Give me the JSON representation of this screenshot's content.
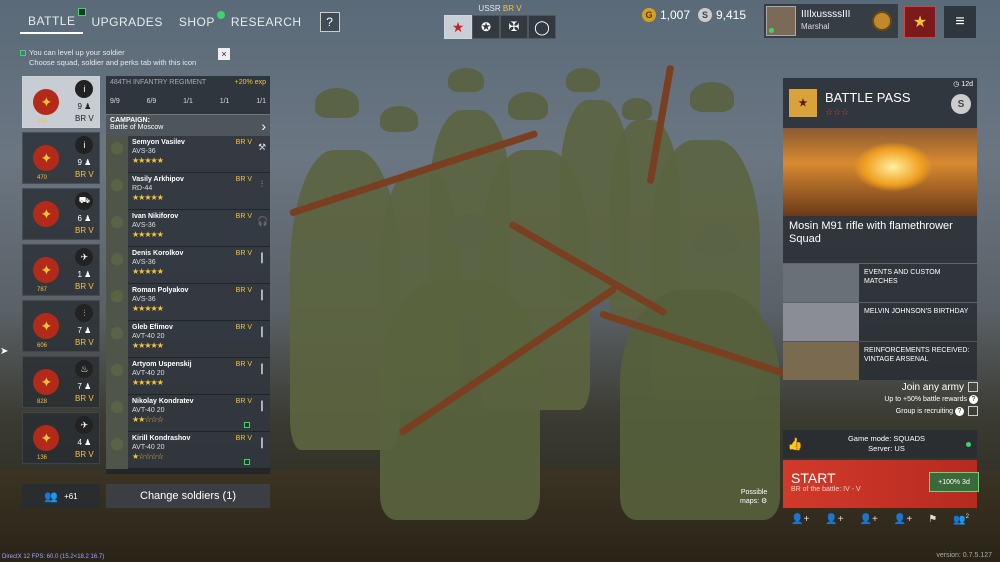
{
  "nav": {
    "tabs": [
      "BATTLE",
      "UPGRADES",
      "SHOP",
      "RESEARCH"
    ],
    "help": "?"
  },
  "nation": {
    "label": "USSR",
    "br": "BR V"
  },
  "currency": {
    "gold": "1,007",
    "silver": "9,415"
  },
  "profile": {
    "name": "IIIlxussssIII",
    "rank": "Marshal"
  },
  "hint": {
    "line1": "You can level up your soldier",
    "line2": "Choose squad, soldier and perks tab with this icon",
    "close": "×"
  },
  "squads": [
    {
      "level": "484",
      "count": "9",
      "br": "BR V",
      "cls": "i"
    },
    {
      "level": "470",
      "count": "9",
      "br": "BR V",
      "cls": "i"
    },
    {
      "level": "",
      "count": "6",
      "br": "BR V",
      "cls": "⛟"
    },
    {
      "level": "787",
      "count": "1",
      "br": "BR V",
      "cls": "✈"
    },
    {
      "level": "606",
      "count": "7",
      "br": "BR V",
      "cls": "⫶"
    },
    {
      "level": "828",
      "count": "7",
      "br": "BR V",
      "cls": "♨"
    },
    {
      "level": "136",
      "count": "4",
      "br": "BR V",
      "cls": "✈"
    }
  ],
  "regiment": {
    "name": "484TH INFANTRY REGIMENT",
    "exp": "+20% exp",
    "stats": [
      "9/9",
      "6/9",
      "1/1",
      "1/1",
      "1/1"
    ],
    "campaign_label": "CAMPAIGN:",
    "campaign": "Battle of Moscow"
  },
  "soldiers": [
    {
      "name": "Semyon Vasilev",
      "weapon": "AVS-36",
      "stars": "★★★★★",
      "br": "BR V",
      "eq": "⚒"
    },
    {
      "name": "Vasily Arkhipov",
      "weapon": "RD-44",
      "stars": "★★★★★",
      "br": "BR V",
      "eq": "⫶"
    },
    {
      "name": "Ivan Nikiforov",
      "weapon": "AVS-36",
      "stars": "★★★★★",
      "br": "BR V",
      "eq": "🎧"
    },
    {
      "name": "Denis Korolkov",
      "weapon": "AVS-36",
      "stars": "★★★★★",
      "br": "BR V",
      "eq": "┃"
    },
    {
      "name": "Roman Polyakov",
      "weapon": "AVS-36",
      "stars": "★★★★★",
      "br": "BR V",
      "eq": "┃"
    },
    {
      "name": "Gleb Efimov",
      "weapon": "AVT-40 20",
      "stars": "★★★★★",
      "br": "BR V",
      "eq": "┃"
    },
    {
      "name": "Artyom Uspenskij",
      "weapon": "AVT-40 20",
      "stars": "★★★★★",
      "br": "BR V",
      "eq": "┃"
    },
    {
      "name": "Nikolay Kondratev",
      "weapon": "AVT-40 20",
      "stars": "★★☆☆☆",
      "br": "BR V",
      "eq": "┃"
    },
    {
      "name": "Kirill Kondrashov",
      "weapon": "AVT-40 20",
      "stars": "★☆☆☆☆",
      "br": "BR V",
      "eq": "┃"
    }
  ],
  "reserve": "+61",
  "change_soldiers": "Change soldiers (1)",
  "battlepass": {
    "title": "BATTLE PASS",
    "stars": "☆☆☆",
    "days": "12d",
    "silver": "S",
    "caption": "Mosin M91 rifle with flamethrower Squad"
  },
  "events": [
    {
      "text": "EVENTS AND CUSTOM MATCHES"
    },
    {
      "text": "MELVIN JOHNSON'S BIRTHDAY"
    },
    {
      "text": "REINFORCEMENTS RECEIVED: VINTAGE ARSENAL"
    }
  ],
  "join": {
    "title": "Join any army",
    "bonus": "Up to +50% battle rewards",
    "recruit": "Group is recruiting"
  },
  "mode": {
    "line1": "Game mode: SQUADS",
    "line2": "Server: US"
  },
  "start": {
    "label": "START",
    "br": "BR of the battle: IV - V",
    "xp": "+100% 3d"
  },
  "maps": {
    "line1": "Possible",
    "line2": "maps:"
  },
  "footer": {
    "debug": "DirectX 12 FPS: 60.0 (15.2<18.2 16.7)",
    "version": "version: 0.7.5.127",
    "friends": "2"
  }
}
